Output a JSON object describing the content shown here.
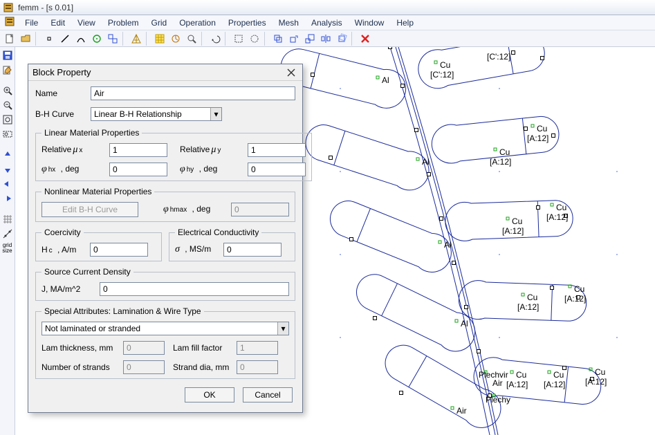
{
  "window": {
    "title": "femm - [s 0.01]"
  },
  "menu": {
    "file": "File",
    "edit": "Edit",
    "view": "View",
    "problem": "Problem",
    "grid": "Grid",
    "operation": "Operation",
    "properties": "Properties",
    "mesh": "Mesh",
    "analysis": "Analysis",
    "window_": "Window",
    "help": "Help"
  },
  "dialog": {
    "title": "Block Property",
    "name_label": "Name",
    "name_value": "Air",
    "bh_label": "B-H Curve",
    "bh_value": "Linear B-H Relationship",
    "linear_legend": "Linear Material Properties",
    "rel_mux_label": "Relative",
    "rel_mux_value": "1",
    "rel_muy_label": "Relative",
    "rel_muy_value": "1",
    "phi_hx_label": ", deg",
    "phi_hx_value": "0",
    "phi_hy_label": ", deg",
    "phi_hy_value": "0",
    "nonlinear_legend": "Nonlinear Material Properties",
    "edit_bh_btn": "Edit B-H Curve",
    "phi_hmax_label": ", deg",
    "phi_hmax_value": "0",
    "coercivity_legend": "Coercivity",
    "hc_label": ", A/m",
    "hc_value": "0",
    "elec_legend": "Electrical Conductivity",
    "sigma_label": ", MS/m",
    "sigma_value": "0",
    "src_legend": "Source Current Density",
    "j_label": "J, MA/m^2",
    "j_value": "0",
    "special_legend": "Special Attributes:  Lamination & Wire Type",
    "special_value": "Not laminated or stranded",
    "lam_thick_label": "Lam thickness, mm",
    "lam_thick_value": "0",
    "lam_fill_label": "Lam fill factor",
    "lam_fill_value": "1",
    "strands_label": "Number of strands",
    "strands_value": "0",
    "strand_dia_label": "Strand dia, mm",
    "strand_dia_value": "0",
    "ok": "OK",
    "cancel": "Cancel"
  },
  "canvas_labels": {
    "c12a": "[C':12]",
    "cu": "Cu",
    "al": "Al",
    "air": "Air",
    "a12": "[A:12]",
    "cp12": "[C':12]",
    "plechv": "Plechvir",
    "plechy": "Plechy"
  }
}
